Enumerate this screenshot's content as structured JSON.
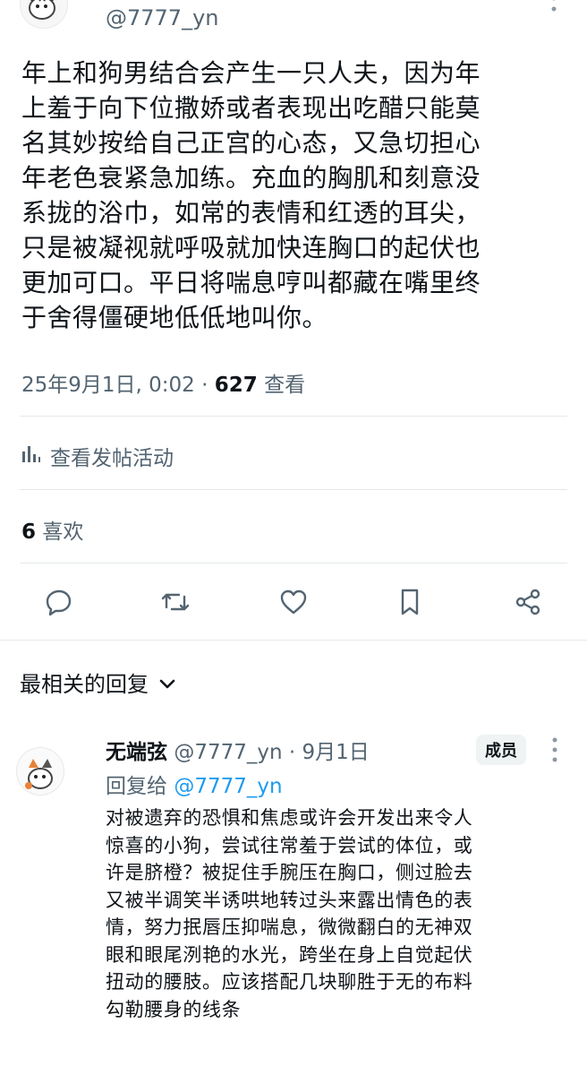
{
  "post": {
    "handle": "@7777_yn",
    "lines": [
      "年上和狗男结合会产生一只人夫，因为年",
      "上羞于向下位撒娇或者表现出吃醋只能莫",
      "名其妙按给自己正宫的心态，又急切担心",
      "年老色衰紧急加练。充血的胸肌和刻意没",
      "系拢的浴巾，如常的表情和红透的耳尖，",
      "只是被凝视就呼吸就加快连胸口的起伏也",
      "更加可口。平日将喘息哼叫都藏在嘴里终",
      "于舍得僵硬地低低地叫你。"
    ],
    "timestamp": "25年9月1日, 0:02 · ",
    "views_count": "627",
    "views_label": "查看",
    "activity_label": "查看发帖活动",
    "likes_count": "6",
    "likes_label": "喜欢"
  },
  "actions": [
    "reply",
    "retweet",
    "like",
    "bookmark",
    "share"
  ],
  "replies_header": {
    "label": "最相关的回复",
    "chevron": "chevron-down-icon"
  },
  "reply": {
    "name": "无端弦",
    "meta": "@7777_yn · 9月1日",
    "badge": "成员",
    "reply_to_prefix": "回复给 ",
    "reply_to_handle": "@7777_yn",
    "lines": [
      "对被遗弃的恐惧和焦虑或许会开发出来令人",
      "惊喜的小狗，尝试往常羞于尝试的体位，或",
      "许是脐橙？被捉住手腕压在胸口，侧过脸去",
      "又被半调笑半诱哄地转过头来露出情色的表",
      "情，努力抿唇压抑喘息，微微翻白的无神双",
      "眼和眼尾洌艳的水光，跨坐在身上自觉起伏",
      "扭动的腰肢。应该搭配几块聊胜于无的布料",
      "勾勒腰身的线条"
    ]
  },
  "colors": {
    "text": "#0f1419",
    "muted": "#536471",
    "link": "#1d9bf0",
    "divider": "#e4e8eb",
    "badge_bg": "#eff3f4"
  }
}
